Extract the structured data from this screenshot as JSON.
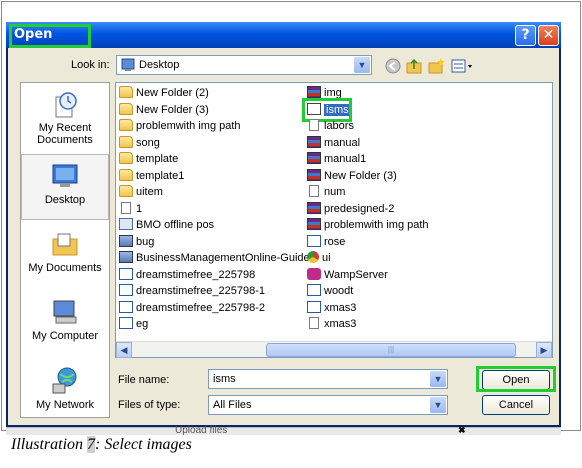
{
  "dialog": {
    "title": "Open",
    "help_glyph": "?",
    "close_glyph": "✕"
  },
  "toolbar": {
    "look_in_label": "Look in:",
    "look_in_value": "Desktop",
    "look_in_icon": "desktop-icon",
    "icons": [
      "back-icon",
      "up-folder-icon",
      "new-folder-icon",
      "views-menu-icon"
    ]
  },
  "places": [
    {
      "label": "My Recent Documents",
      "icon": "recent-documents-icon"
    },
    {
      "label": "Desktop",
      "icon": "desktop-icon",
      "selected": true
    },
    {
      "label": "My Documents",
      "icon": "my-documents-icon"
    },
    {
      "label": "My Computer",
      "icon": "my-computer-icon"
    },
    {
      "label": "My Network",
      "icon": "my-network-icon"
    }
  ],
  "files": {
    "left_column": [
      {
        "name": "New Folder (2)",
        "icon": "folder"
      },
      {
        "name": "New Folder (3)",
        "icon": "folder"
      },
      {
        "name": "problemwith img path",
        "icon": "folder"
      },
      {
        "name": "song",
        "icon": "folder"
      },
      {
        "name": "template",
        "icon": "folder"
      },
      {
        "name": "template1",
        "icon": "folder"
      },
      {
        "name": "uitem",
        "icon": "folder"
      },
      {
        "name": "1",
        "icon": "doc"
      },
      {
        "name": "BMO offline pos",
        "icon": "prog"
      },
      {
        "name": "bug",
        "icon": "img"
      },
      {
        "name": "BusinessManagementOnline-Guide",
        "icon": "img"
      },
      {
        "name": "dreamstimefree_225798",
        "icon": "wx"
      },
      {
        "name": "dreamstimefree_225798-1",
        "icon": "wx"
      },
      {
        "name": "dreamstimefree_225798-2",
        "icon": "wx"
      },
      {
        "name": "eg",
        "icon": "wx"
      }
    ],
    "right_column": [
      {
        "name": "img",
        "icon": "rar"
      },
      {
        "name": "isms",
        "icon": "bat",
        "selected": true
      },
      {
        "name": "labors",
        "icon": "doc"
      },
      {
        "name": "manual",
        "icon": "rar"
      },
      {
        "name": "manual1",
        "icon": "rar"
      },
      {
        "name": "New Folder (3)",
        "icon": "rar"
      },
      {
        "name": "num",
        "icon": "doc"
      },
      {
        "name": "predesigned-2",
        "icon": "rar"
      },
      {
        "name": "problemwith img path",
        "icon": "rar"
      },
      {
        "name": "rose",
        "icon": "wx"
      },
      {
        "name": "ui",
        "icon": "chrome"
      },
      {
        "name": "WampServer",
        "icon": "wamp"
      },
      {
        "name": "woodt",
        "icon": "wx"
      },
      {
        "name": "xmas3",
        "icon": "wx"
      },
      {
        "name": "xmas3",
        "icon": "doc"
      }
    ]
  },
  "form": {
    "file_name_label": "File name:",
    "file_name_value": "isms",
    "file_type_label": "Files of type:",
    "file_type_value": "All Files",
    "open_label": "Open",
    "cancel_label": "Cancel"
  },
  "background_strip": {
    "text": "Upload files",
    "close_glyph": "✖"
  },
  "caption": {
    "prefix": "Illustration ",
    "number": "7",
    "suffix": ": Select images"
  },
  "colors": {
    "title_bar": "#0054e3",
    "highlight": "#22cc33",
    "selection": "#316ac5"
  }
}
